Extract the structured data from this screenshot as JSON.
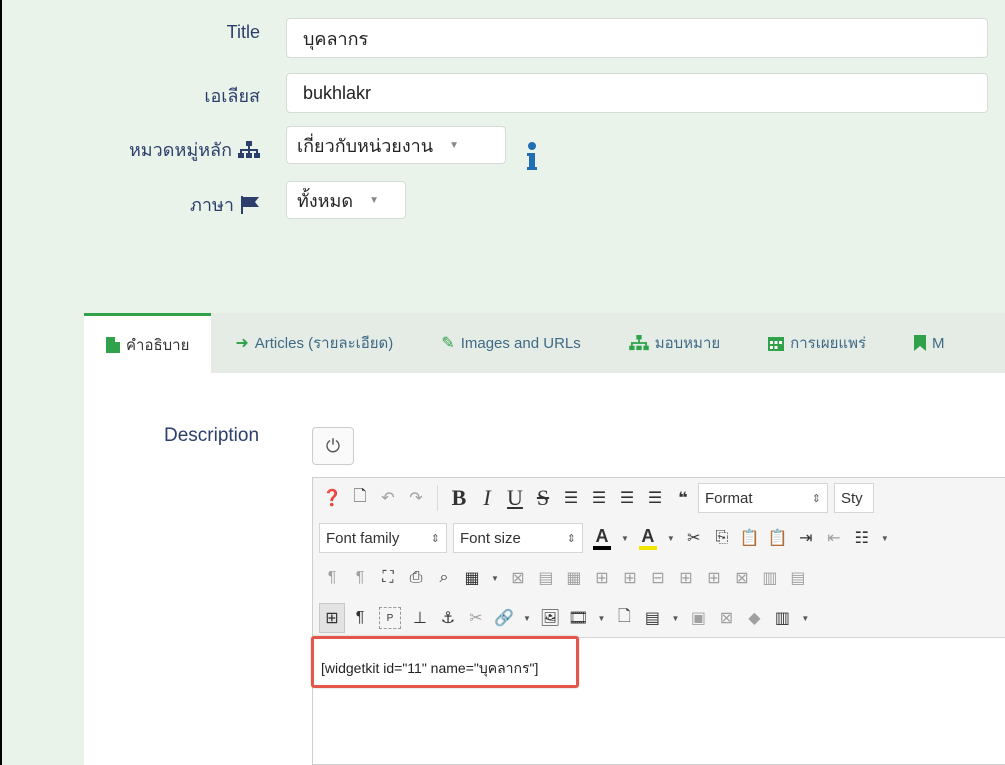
{
  "form": {
    "title_label": "Title",
    "title_value": "บุคลากร",
    "alias_label": "เอเลียส",
    "alias_value": "bukhlakr",
    "category_label": "หมวดหมู่หลัก",
    "category_value": "เกี่ยวกับหน่วยงาน",
    "language_label": "ภาษา",
    "language_value": "ทั้งหมด"
  },
  "tabs": [
    {
      "label": "คำอธิบาย",
      "icon": "file-icon"
    },
    {
      "label": "Articles (รายละเอียด)",
      "icon": "arrow-right-icon"
    },
    {
      "label": "Images and URLs",
      "icon": "pencil-icon"
    },
    {
      "label": "มอบหมาย",
      "icon": "sitemap-icon"
    },
    {
      "label": "การเผยแพร่",
      "icon": "calendar-icon"
    },
    {
      "label": "M",
      "icon": "bookmark-icon"
    }
  ],
  "editor": {
    "description_label": "Description",
    "format_label": "Format",
    "styles_label": "Sty",
    "font_family_label": "Font family",
    "font_size_label": "Font size",
    "content": "[widgetkit id=\"11\" name=\"บุคลากร\"]",
    "text_color": "#000000",
    "highlight_color": "#f2e600",
    "callout_color": "#e4554a"
  },
  "colors": {
    "accent": "#2fa24a",
    "label": "#2c3e6b",
    "info_icon": "#1f6fb2"
  }
}
